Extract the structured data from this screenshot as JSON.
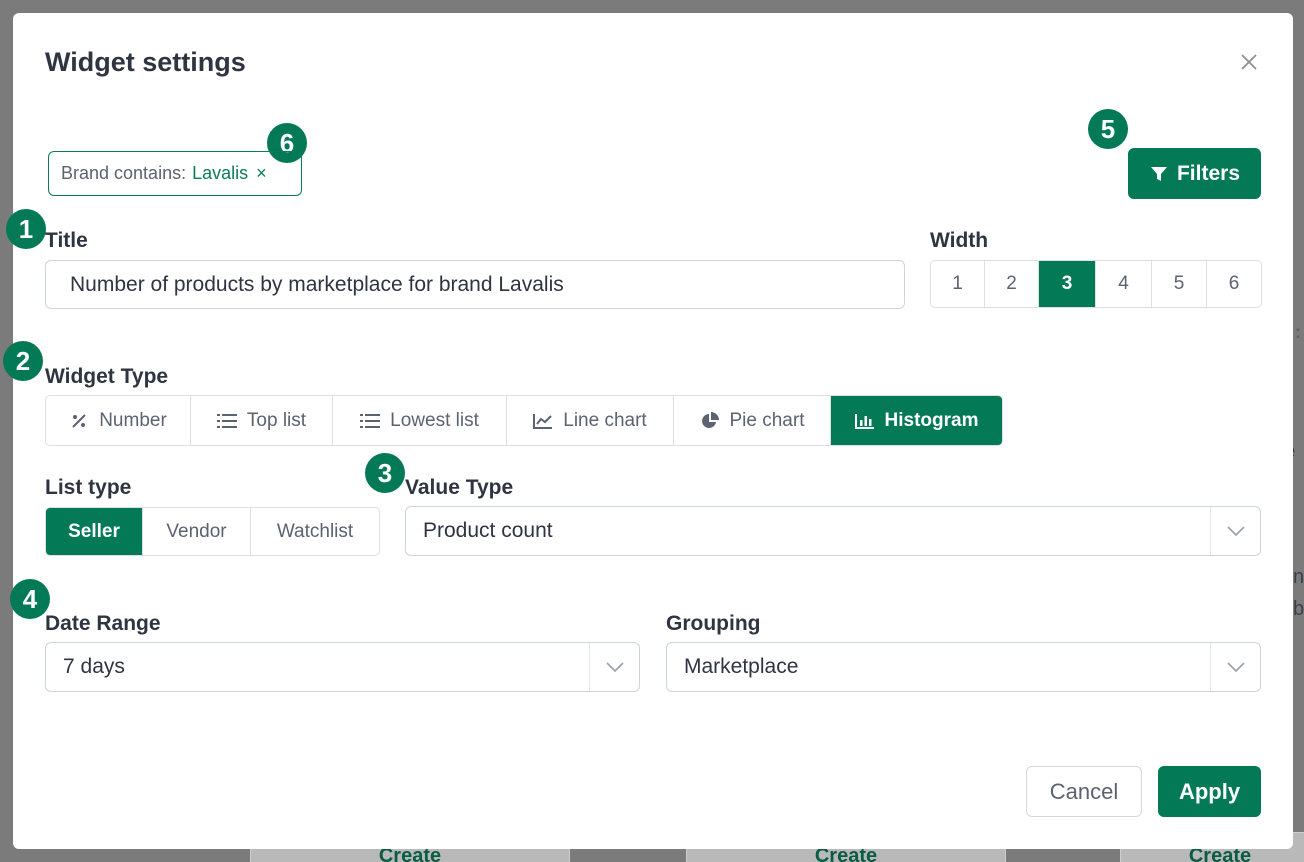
{
  "background": {
    "fragments": [
      "e",
      ":",
      "n",
      "b"
    ],
    "buttons": [
      "Create",
      "Create",
      "Create"
    ]
  },
  "modal": {
    "title": "Widget settings",
    "filter_chip": {
      "label": "Brand contains:",
      "value": "Lavalis",
      "remove": "×"
    },
    "filters_button": "Filters",
    "badges": [
      "1",
      "2",
      "3",
      "4",
      "5",
      "6"
    ],
    "title_field": {
      "label": "Title",
      "value": "Number of products by marketplace for brand Lavalis"
    },
    "width": {
      "label": "Width",
      "options": [
        "1",
        "2",
        "3",
        "4",
        "5",
        "6"
      ],
      "selected": "3"
    },
    "widget_type": {
      "label": "Widget Type",
      "options": [
        {
          "label": "Number",
          "icon": "percent-icon"
        },
        {
          "label": "Top list",
          "icon": "list-icon"
        },
        {
          "label": "Lowest list",
          "icon": "list-icon"
        },
        {
          "label": "Line chart",
          "icon": "line-chart-icon"
        },
        {
          "label": "Pie chart",
          "icon": "pie-chart-icon"
        },
        {
          "label": "Histogram",
          "icon": "bar-chart-icon"
        }
      ],
      "selected": "Histogram"
    },
    "list_type": {
      "label": "List type",
      "options": [
        "Seller",
        "Vendor",
        "Watchlist"
      ],
      "selected": "Seller"
    },
    "value_type": {
      "label": "Value Type",
      "value": "Product count"
    },
    "date_range": {
      "label": "Date Range",
      "value": "7 days"
    },
    "grouping": {
      "label": "Grouping",
      "value": "Marketplace"
    },
    "cancel_button": "Cancel",
    "apply_button": "Apply",
    "colors": {
      "accent": "#037a55",
      "text": "#2f3441",
      "muted": "#5c6270"
    }
  }
}
